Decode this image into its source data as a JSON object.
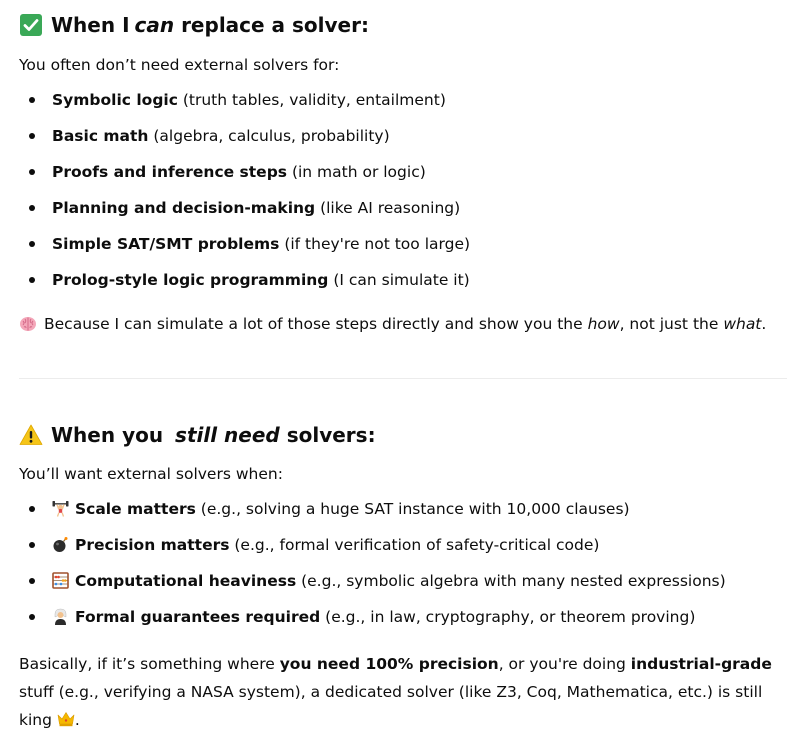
{
  "section1": {
    "title_pre": "When I ",
    "title_em": "can",
    "title_post": " replace a solver:",
    "title_icon": "check-mark-icon",
    "intro": "You often don’t need external solvers for:",
    "items": [
      {
        "bold": "Symbolic logic",
        "rest": " (truth tables, validity, entailment)"
      },
      {
        "bold": "Basic math",
        "rest": " (algebra, calculus, probability)"
      },
      {
        "bold": "Proofs and inference steps",
        "rest": " (in math or logic)"
      },
      {
        "bold": "Planning and decision-making",
        "rest": " (like AI reasoning)"
      },
      {
        "bold": "Simple SAT/SMT problems",
        "rest": " (if they're not too large)"
      },
      {
        "bold": "Prolog-style logic programming",
        "rest": " (I can simulate it)"
      }
    ],
    "note_icon": "brain-icon",
    "note_pre": "Because I can simulate a lot of those steps directly and show you the ",
    "note_em1": "how",
    "note_mid": ", not just the ",
    "note_em2": "what",
    "note_post": "."
  },
  "section2": {
    "title_pre": "When you ",
    "title_em": "still need",
    "title_post": " solvers:",
    "title_icon": "warning-icon",
    "intro": "You’ll want external solvers when:",
    "items": [
      {
        "icon": "weightlifter-icon",
        "bold": "Scale matters",
        "rest": " (e.g., solving a huge SAT instance with 10,000 clauses)"
      },
      {
        "icon": "bomb-icon",
        "bold": "Precision matters",
        "rest": " (e.g., formal verification of safety-critical code)"
      },
      {
        "icon": "abacus-icon",
        "bold": "Computational heaviness",
        "rest": " (e.g., symbolic algebra with many nested expressions)"
      },
      {
        "icon": "judge-icon",
        "bold": "Formal guarantees required",
        "rest": " (e.g., in law, cryptography, or theorem proving)"
      }
    ]
  },
  "closing": {
    "pre": "Basically, if it’s something where ",
    "bold1": "you need 100% precision",
    "mid": ", or you're doing ",
    "bold2": "industrial-grade",
    "post": " stuff (e.g., verifying a NASA system), a dedicated solver (like Z3, Coq, Mathematica, etc.) is still king ",
    "end_icon": "crown-icon",
    "end": "."
  },
  "colors": {
    "text": "#0d0d0d",
    "check_green": "#3aa857",
    "warning_yellow": "#f5c518",
    "divider": "#ececec"
  }
}
